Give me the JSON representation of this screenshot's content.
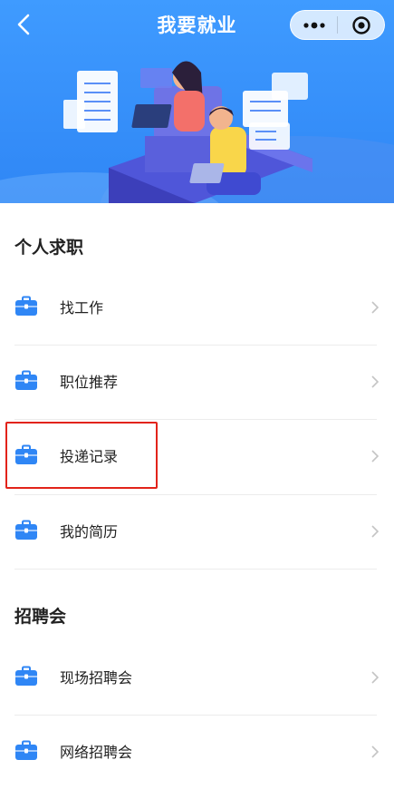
{
  "nav": {
    "title": "我要就业",
    "back_icon": "chevron-left-icon",
    "more_icon": "more-dots-icon",
    "close_icon": "target-close-icon"
  },
  "sections": [
    {
      "title": "个人求职",
      "items": [
        {
          "label": "找工作",
          "icon": "briefcase-icon"
        },
        {
          "label": "职位推荐",
          "icon": "briefcase-icon"
        },
        {
          "label": "投递记录",
          "icon": "briefcase-icon",
          "highlighted": true
        },
        {
          "label": "我的简历",
          "icon": "briefcase-icon"
        }
      ]
    },
    {
      "title": "招聘会",
      "items": [
        {
          "label": "现场招聘会",
          "icon": "briefcase-icon"
        },
        {
          "label": "网络招聘会",
          "icon": "briefcase-icon"
        }
      ]
    }
  ],
  "colors": {
    "header_blue": "#3f9bff",
    "icon_blue": "#2f86f5",
    "highlight_red": "#e2231a"
  }
}
